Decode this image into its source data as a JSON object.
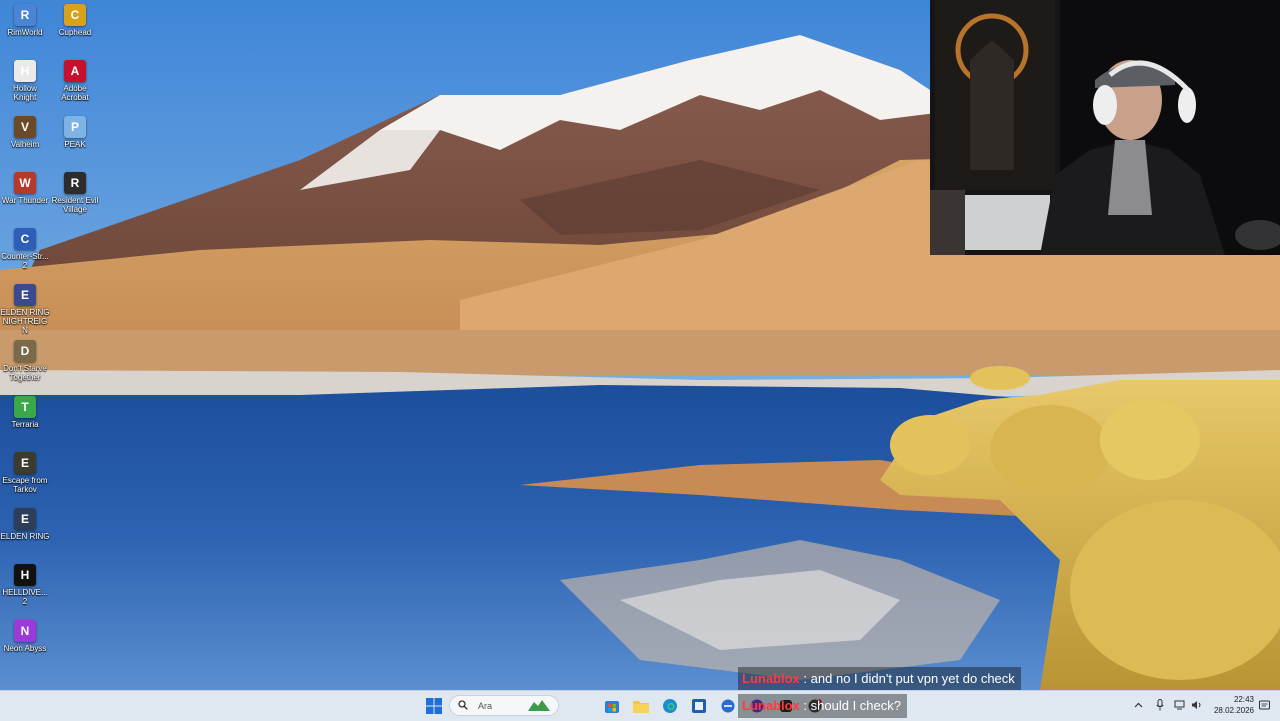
{
  "desktop": {
    "icons": [
      {
        "label": "RimWorld",
        "color": "#4a84d4",
        "glyph": "R"
      },
      {
        "label": "Cuphead",
        "color": "#d9a21c",
        "glyph": "C"
      },
      {
        "label": "Hollow\nKnight",
        "color": "#eaeaea",
        "glyph": "H"
      },
      {
        "label": "Adobe\nAcrobat",
        "color": "#c8102e",
        "glyph": "A"
      },
      {
        "label": "Valheim",
        "color": "#6b4a2a",
        "glyph": "V"
      },
      {
        "label": "PEAK",
        "color": "#7fb3e6",
        "glyph": "P"
      },
      {
        "label": "War Thunder",
        "color": "#b33a2c",
        "glyph": "W"
      },
      {
        "label": "Resident Evil\nVillage",
        "color": "#2d2d2d",
        "glyph": "R"
      },
      {
        "label": "Counter-Str...\n2",
        "color": "#2e5fb8",
        "glyph": "C"
      },
      {
        "label": "ELDEN RING\nNIGHTREIGN",
        "color": "#3a4a8c",
        "glyph": "E"
      },
      {
        "label": "Don't Starve\nTogether",
        "color": "#7a6a4a",
        "glyph": "D"
      },
      {
        "label": "Terraria",
        "color": "#3aa84a",
        "glyph": "T"
      },
      {
        "label": "Escape from\nTarkov",
        "color": "#3b3b30",
        "glyph": "E"
      },
      {
        "label": "ELDEN RING",
        "color": "#2d3e5a",
        "glyph": "E"
      },
      {
        "label": "HELLDIVE...\n2",
        "color": "#111111",
        "glyph": "H"
      },
      {
        "label": "Neon Abyss",
        "color": "#9b3ad8",
        "glyph": "N"
      }
    ]
  },
  "chat": {
    "messages": [
      {
        "user": "Lunablox",
        "text": "and no I didn't put vpn yet do check"
      },
      {
        "user": "Lunablox",
        "text": "should I check?"
      }
    ],
    "separator": ":",
    "user_color": "#ff3b3b"
  },
  "taskbar": {
    "search_placeholder": "Ara",
    "pinned_icons": [
      "windows-start-icon",
      "widgets-icon",
      "microsoft-store-icon",
      "file-explorer-icon",
      "edge-icon",
      "app-icon",
      "app-icon-2",
      "app-icon-3",
      "app-icon-4",
      "app-icon-5"
    ],
    "tray": {
      "time": "22:43",
      "date": "28.02.2026"
    }
  },
  "colors": {
    "taskbar_bg": "#dfe7f1",
    "start_blue": "#1f6fd6"
  }
}
